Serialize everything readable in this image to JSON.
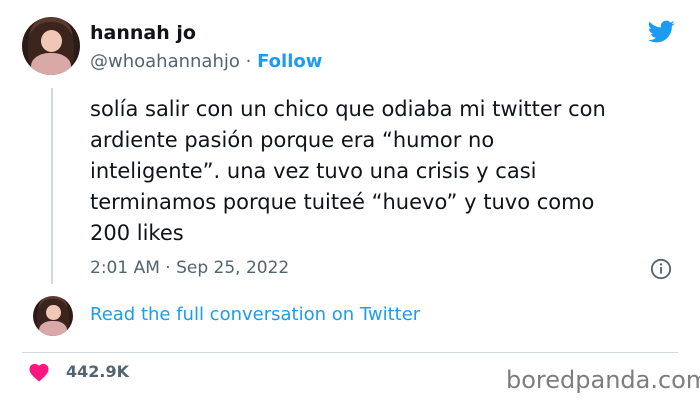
{
  "author": {
    "name": "hannah jo",
    "handle": "@whoahannahjo",
    "separator": "·",
    "follow_label": "Follow"
  },
  "tweet": {
    "lines": [
      "solía salir con un chico que odiaba mi twitter con",
      "ardiente pasión porque era “humor no",
      "inteligente”. una vez tuvo una crisis y casi",
      "terminamos porque tuiteé “huevo” y tuvo como",
      "200 likes"
    ],
    "timestamp": "2:01 AM · Sep 25, 2022"
  },
  "conversation_link": "Read the full conversation on Twitter",
  "likes": {
    "count": "442.9K"
  },
  "watermark": "boredpanda.com",
  "colors": {
    "twitter_blue": "#1d9bf0",
    "heart": "#f91880",
    "muted": "#536471"
  },
  "icons": [
    "twitter-bird-icon",
    "info-icon",
    "heart-icon"
  ]
}
